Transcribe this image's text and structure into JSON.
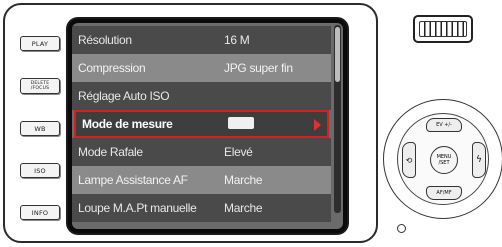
{
  "side_buttons": [
    {
      "label": "PLAY"
    },
    {
      "label": "DELETE\n/FOCUS"
    },
    {
      "label": "WB"
    },
    {
      "label": "ISO"
    },
    {
      "label": "INFO"
    }
  ],
  "menu": {
    "rows": [
      {
        "label": "Résolution",
        "value": "16 M"
      },
      {
        "label": "Compression",
        "value": "JPG super fin"
      },
      {
        "label": "Réglage Auto ISO",
        "value": ""
      },
      {
        "label": "Mode de mesure",
        "value": "",
        "selected": true
      },
      {
        "label": "Mode Rafale",
        "value": "Elevé"
      },
      {
        "label": "Lampe Assistance AF",
        "value": "Marche"
      },
      {
        "label": "Loupe M.A.Pt manuelle",
        "value": "Marche"
      }
    ],
    "scroll_position": 0.0
  },
  "dial": {
    "top_label": "EV +/-",
    "bottom_label": "AF/MF",
    "left_label": "⟲",
    "right_label": "ϟ",
    "center_label": "MENU\n/SET"
  },
  "colors": {
    "selection_border": "#d42020",
    "arrow": "#e23030"
  }
}
